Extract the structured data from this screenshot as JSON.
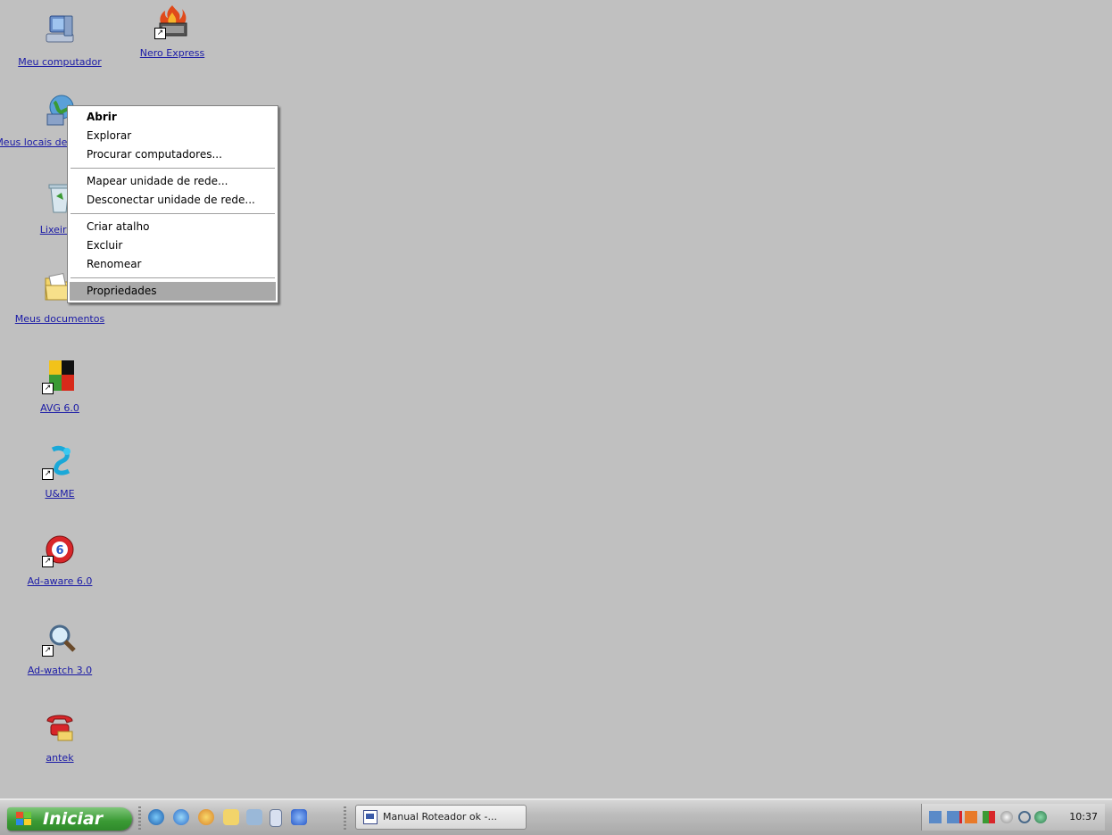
{
  "desktop": {
    "icons": [
      {
        "label": "Meu computador"
      },
      {
        "label": "Nero Express"
      },
      {
        "label": "Meus locais de rede"
      },
      {
        "label": "Lixeira"
      },
      {
        "label": "Meus documentos"
      },
      {
        "label": "AVG 6.0"
      },
      {
        "label": "U&ME"
      },
      {
        "label": "Ad-aware 6.0"
      },
      {
        "label": "Ad-watch 3.0"
      },
      {
        "label": "antek"
      }
    ]
  },
  "context_menu": {
    "items": [
      {
        "label": "Abrir",
        "bold": true
      },
      {
        "label": "Explorar"
      },
      {
        "label": "Procurar computadores..."
      },
      {
        "label": "Mapear unidade de rede..."
      },
      {
        "label": "Desconectar unidade de rede..."
      },
      {
        "label": "Criar atalho"
      },
      {
        "label": "Excluir"
      },
      {
        "label": "Renomear"
      },
      {
        "label": "Propriedades",
        "selected": true
      }
    ]
  },
  "taskbar": {
    "start_label": "Iniciar",
    "task_button_label": "Manual Roteador ok -...",
    "clock": "10:37"
  },
  "colors": {
    "desktop_background": "#c0c0c0",
    "start_button": "#3a9a34",
    "icon_label": "#1a1aa6",
    "menu_highlight": "#a9a9a9"
  }
}
